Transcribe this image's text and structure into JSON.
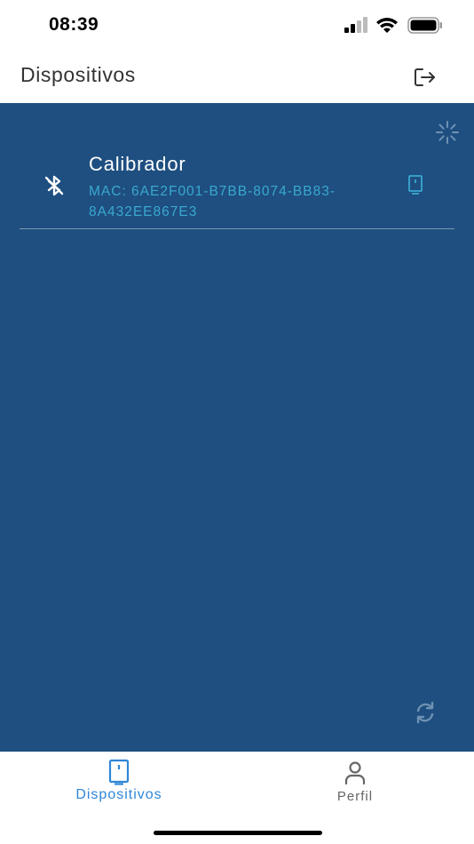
{
  "status_bar": {
    "time": "08:39"
  },
  "header": {
    "title": "Dispositivos",
    "logout_icon": "logout-icon"
  },
  "device_list": [
    {
      "name": "Calibrador",
      "mac": "MAC: 6AE2F001-B7BB-8074-BB83-8A432EE867E3",
      "status_icon": "bluetooth-disabled-icon",
      "action_icon": "device-icon"
    }
  ],
  "colors": {
    "content_bg": "#1e4f80",
    "mac_text": "#3aa8cf",
    "nav_active": "#2f86d6",
    "nav_inactive": "#666666"
  },
  "bottom_nav": {
    "items": [
      {
        "label": "Dispositivos",
        "icon": "device-icon",
        "active": true
      },
      {
        "label": "Perfil",
        "icon": "person-icon",
        "active": false
      }
    ]
  }
}
